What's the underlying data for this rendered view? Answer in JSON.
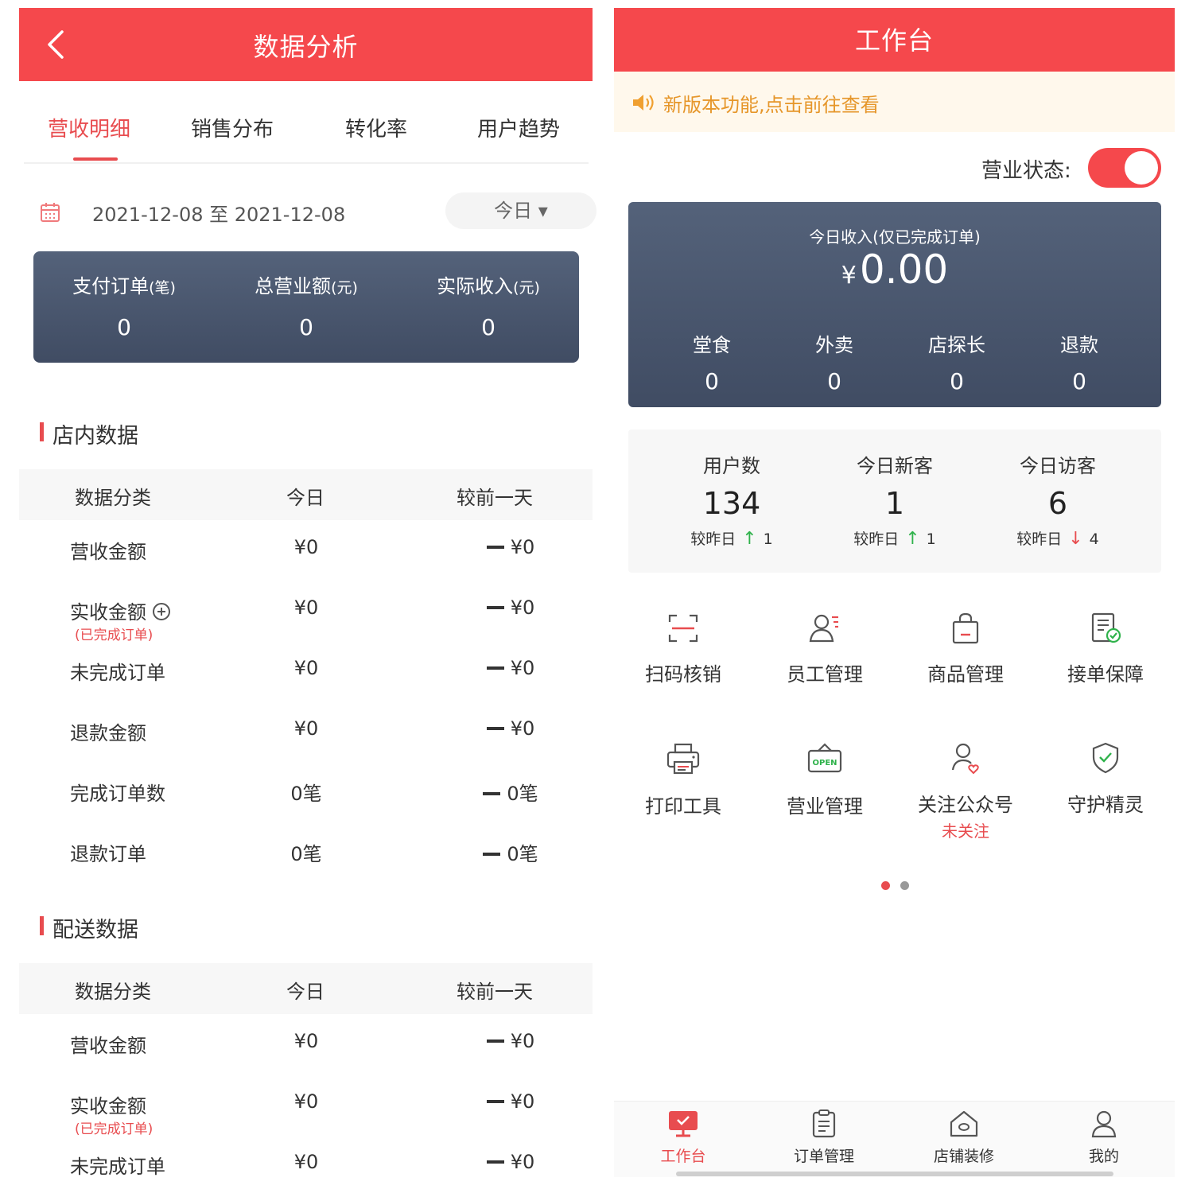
{
  "left": {
    "header_title": "数据分析",
    "tabs": [
      "营收明细",
      "销售分布",
      "转化率",
      "用户趋势"
    ],
    "active_tab": 0,
    "date_range": "2021-12-08 至 2021-12-08",
    "date_picker": "今日 ▾",
    "summary": [
      {
        "label": "支付订单",
        "unit": "(笔)",
        "value": "0"
      },
      {
        "label": "总营业额",
        "unit": "(元)",
        "value": "0"
      },
      {
        "label": "实际收入",
        "unit": "(元)",
        "value": "0"
      }
    ],
    "store_section": {
      "title": "店内数据",
      "headers": [
        "数据分类",
        "今日",
        "较前一天"
      ],
      "rows": [
        {
          "name": "营收金额",
          "today": "¥0",
          "prev": "¥0"
        },
        {
          "name": "实收金额",
          "sub": "(已完成订单)",
          "today": "¥0",
          "prev": "¥0"
        },
        {
          "name": "未完成订单",
          "today": "¥0",
          "prev": "¥0"
        },
        {
          "name": "退款金额",
          "today": "¥0",
          "prev": "¥0"
        },
        {
          "name": "完成订单数",
          "today": "0笔",
          "prev": "0笔"
        },
        {
          "name": "退款订单",
          "today": "0笔",
          "prev": "0笔"
        }
      ]
    },
    "delivery_section": {
      "title": "配送数据",
      "headers": [
        "数据分类",
        "今日",
        "较前一天"
      ],
      "rows": [
        {
          "name": "营收金额",
          "today": "¥0",
          "prev": "¥0"
        },
        {
          "name": "实收金额",
          "sub": "(已完成订单)",
          "today": "¥0",
          "prev": "¥0"
        },
        {
          "name": "未完成订单",
          "today": "¥0",
          "prev": "¥0"
        }
      ]
    }
  },
  "right": {
    "header_title": "工作台",
    "notice": "新版本功能,点击前往查看",
    "status_label": "营业状态:",
    "status_on": true,
    "income": {
      "label": "今日收入(仅已完成订单)",
      "currency": "¥",
      "value": "0.00",
      "breakdown": [
        {
          "label": "堂食",
          "value": "0"
        },
        {
          "label": "外卖",
          "value": "0"
        },
        {
          "label": "店探长",
          "value": "0"
        },
        {
          "label": "退款",
          "value": "0"
        }
      ]
    },
    "users": [
      {
        "label": "用户数",
        "value": "134",
        "compare": "较昨日",
        "trend": "↑",
        "delta": "1"
      },
      {
        "label": "今日新客",
        "value": "1",
        "compare": "较昨日",
        "trend": "↑",
        "delta": "1"
      },
      {
        "label": "今日访客",
        "value": "6",
        "compare": "较昨日",
        "trend": "↓",
        "delta": "4"
      }
    ],
    "grid": [
      {
        "label": "扫码核销",
        "icon": "scan-icon"
      },
      {
        "label": "员工管理",
        "icon": "staff-icon"
      },
      {
        "label": "商品管理",
        "icon": "bag-icon"
      },
      {
        "label": "接单保障",
        "icon": "document-check-icon"
      },
      {
        "label": "打印工具",
        "icon": "printer-icon"
      },
      {
        "label": "营业管理",
        "icon": "open-sign-icon"
      },
      {
        "label": "关注公众号",
        "sub": "未关注",
        "icon": "follow-user-icon"
      },
      {
        "label": "守护精灵",
        "icon": "shield-check-icon"
      }
    ],
    "tabbar": [
      {
        "label": "工作台",
        "icon": "workbench-icon"
      },
      {
        "label": "订单管理",
        "icon": "clipboard-icon"
      },
      {
        "label": "店铺装修",
        "icon": "home-icon"
      },
      {
        "label": "我的",
        "icon": "user-icon"
      }
    ],
    "active_tabbar": 0,
    "colors": {
      "accent": "#f5484c",
      "card": "#4a566d",
      "notice_text": "#e6962a",
      "up": "#2fb24b",
      "down": "#e84c4f"
    }
  }
}
